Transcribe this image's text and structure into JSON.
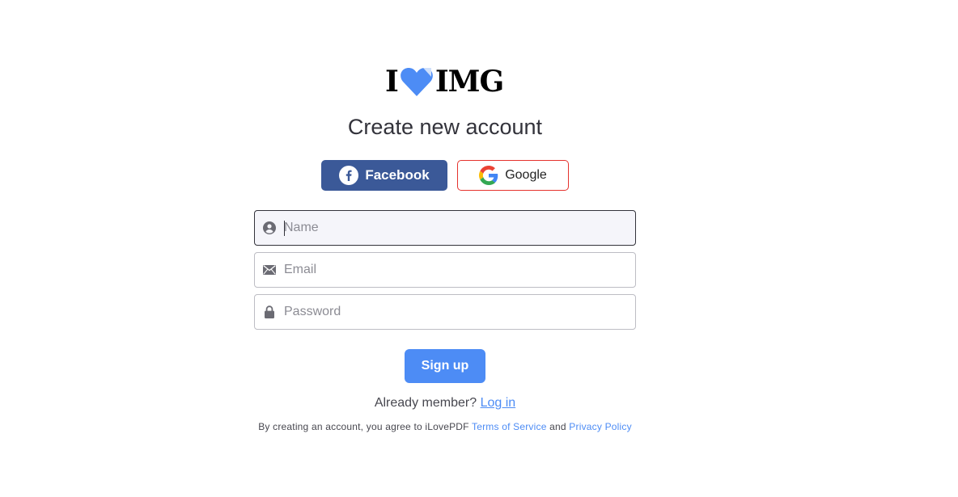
{
  "logo": {
    "left_text": "I",
    "right_text": "IMG",
    "heart_color": "#4d8cf5"
  },
  "title": "Create new account",
  "social": {
    "facebook_label": "Facebook",
    "google_label": "Google"
  },
  "form": {
    "name": {
      "placeholder": "Name",
      "value": "",
      "icon": "user-icon"
    },
    "email": {
      "placeholder": "Email",
      "value": "",
      "icon": "envelope-icon"
    },
    "password": {
      "placeholder": "Password",
      "value": "",
      "icon": "lock-icon"
    }
  },
  "signup_label": "Sign up",
  "member": {
    "prompt": "Already member?",
    "login_label": "Log in"
  },
  "terms": {
    "prefix": "By creating an account, you agree to iLovePDF",
    "tos_label": "Terms of Service",
    "and": "and",
    "privacy_label": "Privacy Policy"
  },
  "colors": {
    "accent": "#4d8cf5",
    "facebook": "#3b5998",
    "google_border": "#e5322d",
    "text": "#33333b"
  }
}
